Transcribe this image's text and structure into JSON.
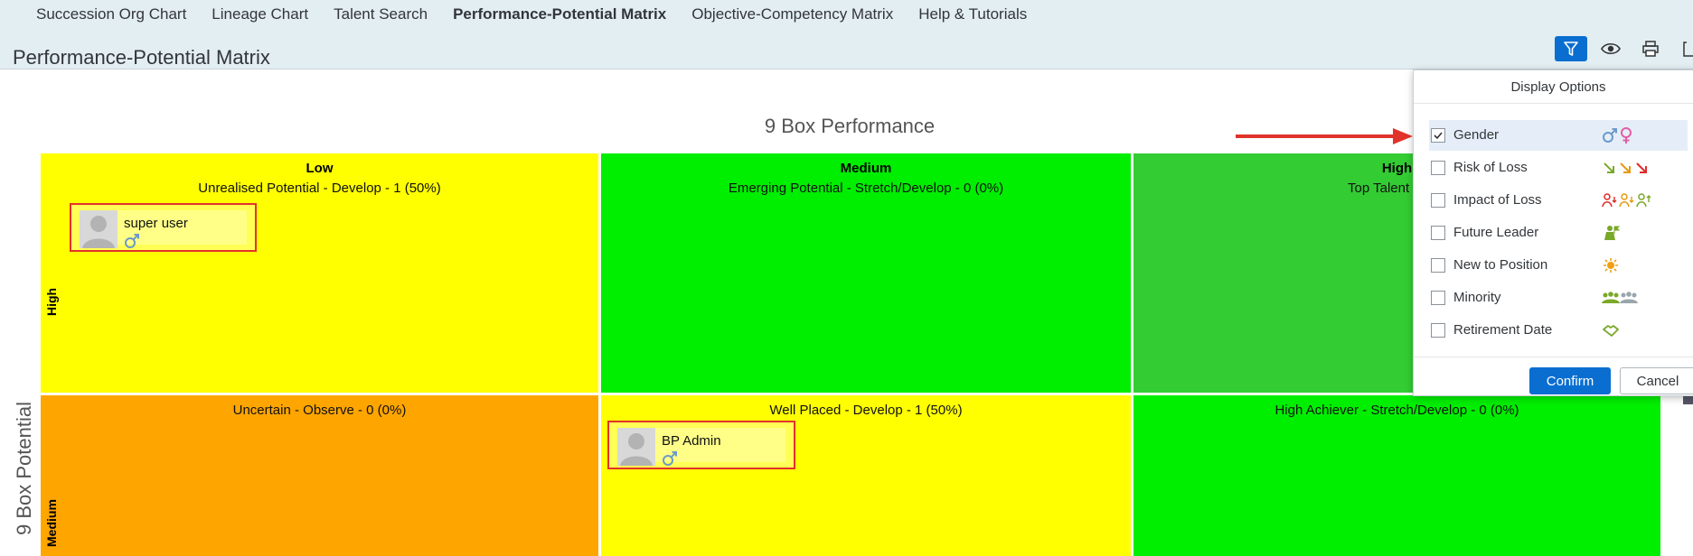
{
  "nav": {
    "items": [
      {
        "label": "Succession Org Chart",
        "active": false
      },
      {
        "label": "Lineage Chart",
        "active": false
      },
      {
        "label": "Talent Search",
        "active": false
      },
      {
        "label": "Performance-Potential Matrix",
        "active": true
      },
      {
        "label": "Objective-Competency Matrix",
        "active": false
      },
      {
        "label": "Help & Tutorials",
        "active": false
      }
    ]
  },
  "page": {
    "title": "Performance-Potential Matrix"
  },
  "toolbar": {
    "icons": [
      "filter-icon",
      "eye-icon",
      "print-icon",
      "export-icon"
    ],
    "accent": "#0a6ed1"
  },
  "matrix": {
    "title": "9 Box Performance",
    "y_title": "9 Box Potential",
    "columns": [
      "Low",
      "Medium",
      "High"
    ],
    "rows": [
      "High",
      "Medium"
    ],
    "cells": {
      "r0c0": {
        "label": "Unrealised Potential - Develop - 1 (50%)",
        "color": "#ffff00"
      },
      "r0c1": {
        "label": "Emerging Potential - Stretch/Develop - 0 (0%)",
        "color": "#00ee00"
      },
      "r0c2": {
        "label": "Top Talent - Stre",
        "color": "#33cc33"
      },
      "r1c0": {
        "label": "Uncertain - Observe - 0 (0%)",
        "color": "#ffa500"
      },
      "r1c1": {
        "label": "Well Placed - Develop - 1 (50%)",
        "color": "#ffff00"
      },
      "r1c2": {
        "label": "High Achiever - Stretch/Develop - 0 (0%)",
        "color": "#00ee00"
      }
    },
    "column_head_visible_high": "High",
    "people": [
      {
        "name": "super user",
        "gender_icon": "male-icon"
      },
      {
        "name": "BP Admin",
        "gender_icon": "male-icon"
      }
    ]
  },
  "display_options": {
    "title": "Display Options",
    "options": [
      {
        "label": "Gender",
        "checked": true,
        "icons": [
          "male-icon",
          "female-icon"
        ]
      },
      {
        "label": "Risk of Loss",
        "checked": false,
        "icons": [
          "arrow-down-right-green-icon",
          "arrow-down-right-orange-icon",
          "arrow-down-right-red-icon"
        ]
      },
      {
        "label": "Impact of Loss",
        "checked": false,
        "icons": [
          "person-down-red-icon",
          "person-down-orange-icon",
          "person-up-green-icon"
        ]
      },
      {
        "label": "Future Leader",
        "checked": false,
        "icons": [
          "future-leader-icon"
        ]
      },
      {
        "label": "New to Position",
        "checked": false,
        "icons": [
          "sun-icon"
        ]
      },
      {
        "label": "Minority",
        "checked": false,
        "icons": [
          "group-green-icon",
          "group-grey-icon"
        ]
      },
      {
        "label": "Retirement Date",
        "checked": false,
        "icons": [
          "handshake-icon"
        ]
      }
    ],
    "confirm_label": "Confirm",
    "cancel_label": "Cancel"
  }
}
